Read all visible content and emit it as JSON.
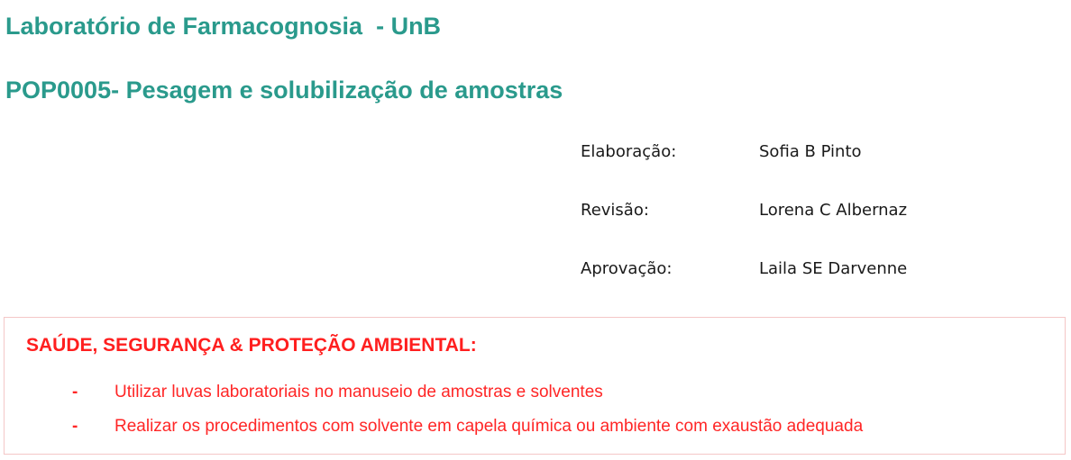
{
  "document": {
    "lab_title": "Laboratório de Farmacognosia  - UnB",
    "pop_title": "POP0005- Pesagem e solubilização de amostras"
  },
  "metadata": [
    {
      "label": "Elaboração:",
      "value": "Sofia B Pinto"
    },
    {
      "label": "Revisão:",
      "value": "Lorena C Albernaz"
    },
    {
      "label": "Aprovação:",
      "value": "Laila SE Darvenne"
    }
  ],
  "safety": {
    "heading": "SAÚDE, SEGURANÇA & PROTEÇÃO AMBIENTAL:",
    "items": [
      {
        "bullet": "-",
        "text": "Utilizar luvas laboratoriais no manuseio de amostras e solventes"
      },
      {
        "bullet": "-",
        "text": "Realizar os procedimentos com solvente em capela química ou ambiente com exaustão adequada"
      }
    ]
  },
  "colors": {
    "title_teal": "#2a9a8c",
    "safety_red": "#ff1f1f",
    "box_border": "#f4c7c7",
    "body_text": "#1a1a1a"
  }
}
